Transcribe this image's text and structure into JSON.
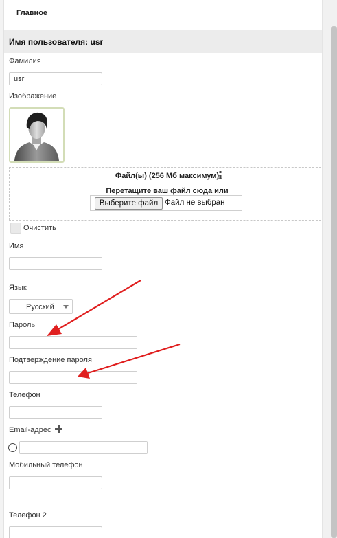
{
  "tabs": {
    "main": "Главное"
  },
  "header": {
    "title": "Имя пользователя: usr"
  },
  "fields": {
    "lastname_label": "Фамилия",
    "lastname_value": "usr",
    "image_label": "Изображение",
    "firstname_label": "Имя",
    "firstname_value": "",
    "language_label": "Язык",
    "language_value": "Русский",
    "password_label": "Пароль",
    "password_confirm_label": "Подтверждение пароля",
    "phone_label": "Телефон",
    "email_label": "Email-адрес",
    "mobile_label": "Мобильный телефон",
    "phone2_label": "Телефон 2"
  },
  "upload": {
    "title": "Файл(ы) (256 Мб максимум)",
    "drop_text": "Перетащите ваш файл сюда или",
    "button_label": "Выберите файл",
    "status": "Файл не выбран"
  },
  "clear": {
    "label": "Очистить"
  },
  "colors": {
    "annotation_arrow": "#e01f1f",
    "avatar_border": "#d3ddb7",
    "header_bg": "#ececec"
  },
  "icons": {
    "info": "info-icon",
    "plus": "plus-icon",
    "avatar": "user-silhouette"
  }
}
